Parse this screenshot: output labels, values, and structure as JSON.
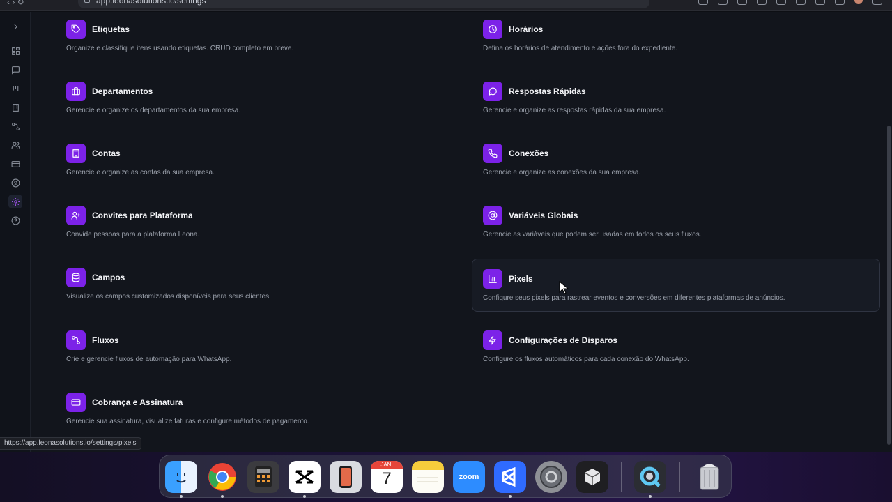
{
  "browser": {
    "url": "app.leonasolutions.io/settings",
    "status_url": "https://app.leonasolutions.io/settings/pixels"
  },
  "sidebar": {
    "items": [
      {
        "name": "expand-icon"
      },
      {
        "name": "dashboard-icon"
      },
      {
        "name": "chat-icon"
      },
      {
        "name": "kanban-icon"
      },
      {
        "name": "building-icon"
      },
      {
        "name": "flow-icon"
      },
      {
        "name": "users-icon"
      },
      {
        "name": "card-icon"
      },
      {
        "name": "profile-icon"
      },
      {
        "name": "settings-icon",
        "active": true
      },
      {
        "name": "help-icon"
      }
    ]
  },
  "settings": {
    "cards": [
      {
        "key": "etiquetas",
        "title": "Etiquetas",
        "desc": "Organize e classifique itens usando etiquetas. CRUD completo em breve.",
        "icon": "tag-icon"
      },
      {
        "key": "horarios",
        "title": "Horários",
        "desc": "Defina os horários de atendimento e ações fora do expediente.",
        "icon": "clock-icon"
      },
      {
        "key": "departamentos",
        "title": "Departamentos",
        "desc": "Gerencie e organize os departamentos da sua empresa.",
        "icon": "briefcase-icon"
      },
      {
        "key": "respostas",
        "title": "Respostas Rápidas",
        "desc": "Gerencie e organize as respostas rápidas da sua empresa.",
        "icon": "message-circle-icon"
      },
      {
        "key": "contas",
        "title": "Contas",
        "desc": "Gerencie e organize as contas da sua empresa.",
        "icon": "building-icon"
      },
      {
        "key": "conexoes",
        "title": "Conexões",
        "desc": "Gerencie e organize as conexões da sua empresa.",
        "icon": "phone-icon"
      },
      {
        "key": "convites",
        "title": "Convites para Plataforma",
        "desc": "Convide pessoas para a plataforma Leona.",
        "icon": "user-plus-icon"
      },
      {
        "key": "variaveis",
        "title": "Variáveis Globais",
        "desc": "Gerencie as variáveis que podem ser usadas em todos os seus fluxos.",
        "icon": "at-sign-icon"
      },
      {
        "key": "campos",
        "title": "Campos",
        "desc": "Visualize os campos customizados disponíveis para seus clientes.",
        "icon": "database-icon"
      },
      {
        "key": "pixels",
        "title": "Pixels",
        "desc": "Configure seus pixels para rastrear eventos e conversões em diferentes plataformas de anúncios.",
        "icon": "bar-chart-icon",
        "hovered": true
      },
      {
        "key": "fluxos",
        "title": "Fluxos",
        "desc": "Crie e gerencie fluxos de automação para WhatsApp.",
        "icon": "workflow-icon"
      },
      {
        "key": "disparos",
        "title": "Configurações de Disparos",
        "desc": "Configure os fluxos automáticos para cada conexão do WhatsApp.",
        "icon": "zap-icon"
      },
      {
        "key": "cobranca",
        "title": "Cobrança e Assinatura",
        "desc": "Gerencie sua assinatura, visualize faturas e configure métodos de pagamento.",
        "icon": "credit-card-icon"
      }
    ]
  },
  "dock": {
    "apps": [
      {
        "name": "finder",
        "label": ""
      },
      {
        "name": "chrome",
        "label": ""
      },
      {
        "name": "calculator",
        "label": ""
      },
      {
        "name": "capcut",
        "label": ""
      },
      {
        "name": "iphone-mirroring",
        "label": ""
      },
      {
        "name": "calendar",
        "month": "JAN.",
        "day": "7"
      },
      {
        "name": "notes",
        "label": ""
      },
      {
        "name": "zoom",
        "label": "zoom"
      },
      {
        "name": "vscode",
        "label": ""
      },
      {
        "name": "system-settings",
        "label": ""
      },
      {
        "name": "cursor-app",
        "label": ""
      },
      {
        "name": "quicktime",
        "label": ""
      },
      {
        "name": "trash",
        "label": ""
      }
    ],
    "colors": {
      "accent": "#7c22e8",
      "zoom": "#2d8cff",
      "vscode": "#2f6bff",
      "chrome_red": "#ea4335"
    }
  }
}
